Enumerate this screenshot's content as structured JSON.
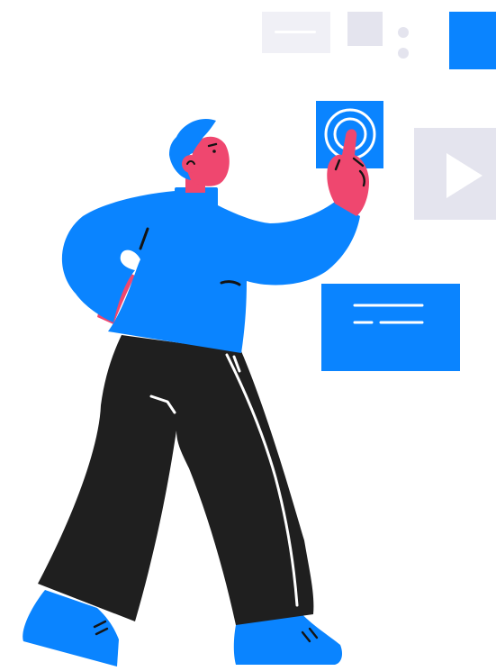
{
  "illustration": {
    "subject": "person-tapping-floating-interface",
    "colors": {
      "primary_blue": "#0a84ff",
      "skin_pink": "#ef476f",
      "pants_black": "#1f1f1f",
      "panel_gray": "#e4e4ee",
      "panel_light": "#f0f0f6",
      "stroke_dark": "#141414",
      "line_white": "#ffffff"
    },
    "icons": {
      "touch": "touch-target-icon",
      "play": "play-icon",
      "text_card": "text-card-icon",
      "dots": "vertical-dots-icon"
    }
  }
}
